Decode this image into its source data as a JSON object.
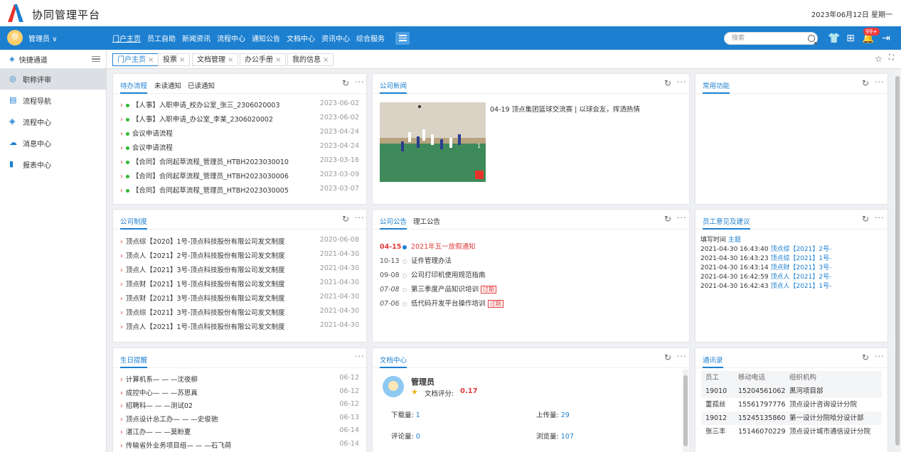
{
  "header": {
    "app_title": "协同管理平台",
    "date": "2023年06月12日 星期一"
  },
  "navbar": {
    "user": "管理员 ∨",
    "items": [
      "门户主页",
      "员工自助",
      "新闻资讯",
      "流程中心",
      "通知公告",
      "文档中心",
      "资讯中心",
      "综合服务"
    ],
    "search_placeholder": "搜索",
    "badge": "99+"
  },
  "sidebar": {
    "head": "快捷通道",
    "items": [
      "职称评审",
      "流程导航",
      "流程中心",
      "消息中心",
      "报表中心"
    ]
  },
  "tabs": [
    "门户主页",
    "投票",
    "文档管理",
    "办公手册",
    "我的信息"
  ],
  "todo": {
    "tabs": [
      "待办流程",
      "未读通知",
      "已读通知"
    ],
    "rows": [
      {
        "t": "【人事】入职申请_校办公室_张三_2306020003",
        "d": "2023-06-02"
      },
      {
        "t": "【人事】入职申请_办公室_李某_2306020002",
        "d": "2023-06-02"
      },
      {
        "t": "会议申请流程",
        "d": "2023-04-24"
      },
      {
        "t": "会议申请流程",
        "d": "2023-04-24"
      },
      {
        "t": "【合同】合同起草流程_管理员_HTBH2023030010",
        "d": "2023-03-16"
      },
      {
        "t": "【合同】合同起草流程_管理员_HTBH2023030006",
        "d": "2023-03-09"
      },
      {
        "t": "【合同】合同起草流程_管理员_HTBH2023030005",
        "d": "2023-03-07"
      }
    ]
  },
  "news": {
    "title": "公司新闻",
    "headline": "04-19 顶点集团篮球交流赛 | 以球会友，挥洒热情",
    "page": "1"
  },
  "common": {
    "title": "常用功能"
  },
  "policy": {
    "title": "公司制度",
    "rows": [
      {
        "t": "顶点综【2020】1号-顶点科技股份有限公司发文制度",
        "d": "2020-06-08"
      },
      {
        "t": "顶点人【2021】2号-顶点科技股份有限公司发文制度",
        "d": "2021-04-30"
      },
      {
        "t": "顶点人【2021】3号-顶点科技股份有限公司发文制度",
        "d": "2021-04-30"
      },
      {
        "t": "顶点财【2021】1号-顶点科技股份有限公司发文制度",
        "d": "2021-04-30"
      },
      {
        "t": "顶点财【2021】3号-顶点科技股份有限公司发文制度",
        "d": "2021-04-30"
      },
      {
        "t": "顶点综【2021】3号-顶点科技股份有限公司发文制度",
        "d": "2021-04-30"
      },
      {
        "t": "顶点人【2021】1号-顶点科技股份有限公司发文制度",
        "d": "2021-04-30"
      }
    ]
  },
  "notice": {
    "tabs": [
      "公司公告",
      "理工公告"
    ],
    "rows": [
      {
        "d": "04-15",
        "t": "2021年五一放假通知",
        "tag": ""
      },
      {
        "d": "10-13",
        "t": "证件管理办法",
        "tag": ""
      },
      {
        "d": "09-08",
        "t": "公司打印机使用规范指南",
        "tag": ""
      },
      {
        "d": "07-08",
        "t": "第三季度产品知识培训",
        "tag": "过期"
      },
      {
        "d": "07-06",
        "t": "低代码开发平台操作培训",
        "tag": "过期"
      }
    ]
  },
  "feedback": {
    "title": "员工意见及建议",
    "head_time": "填写时间",
    "head_subject": "主题",
    "rows": [
      {
        "time": "2021-04-30 16:43:40",
        "s": "顶点综【2021】2号-"
      },
      {
        "time": "2021-04-30 16:43:23",
        "s": "顶点综【2021】1号-"
      },
      {
        "time": "2021-04-30 16:43:14",
        "s": "顶点财【2021】3号-"
      },
      {
        "time": "2021-04-30 16:42:59",
        "s": "顶点人【2021】2号-"
      },
      {
        "time": "2021-04-30 16:42:43",
        "s": "顶点人【2021】1号-"
      }
    ]
  },
  "birthday": {
    "title": "生日提醒",
    "rows": [
      {
        "t": "计算机系— — —沈夜柳",
        "d": "06-12"
      },
      {
        "t": "成控中心— — —苏思真",
        "d": "06-12"
      },
      {
        "t": "招聘科— — —测试02",
        "d": "06-12"
      },
      {
        "t": "顶点设计总工办— — —史俊驰",
        "d": "06-13"
      },
      {
        "t": "湛江办— — —莫盼夏",
        "d": "06-14"
      },
      {
        "t": "传输省外业务项目组— — —石飞荷",
        "d": "06-14"
      }
    ]
  },
  "docs": {
    "title": "文档中心",
    "user": "管理员",
    "score_label": "文档评分:",
    "score": "0.17",
    "stats": [
      {
        "label": "下载量:",
        "value": "1"
      },
      {
        "label": "上传量:",
        "value": "29"
      },
      {
        "label": "评论量:",
        "value": "0"
      },
      {
        "label": "浏览量:",
        "value": "107"
      }
    ]
  },
  "contacts": {
    "title": "通讯录",
    "headers": [
      "员工",
      "移动电话",
      "组织机构"
    ],
    "rows": [
      [
        "19010",
        "15204561062",
        "黑河项目部"
      ],
      [
        "董孤丝",
        "15561797776",
        "顶点设计咨询设计分院"
      ],
      [
        "19012",
        "15245135860",
        "第一设计分院哈分设计部"
      ],
      [
        "张三丰",
        "15146070229",
        "顶点设计城市通信设计分院"
      ]
    ]
  }
}
